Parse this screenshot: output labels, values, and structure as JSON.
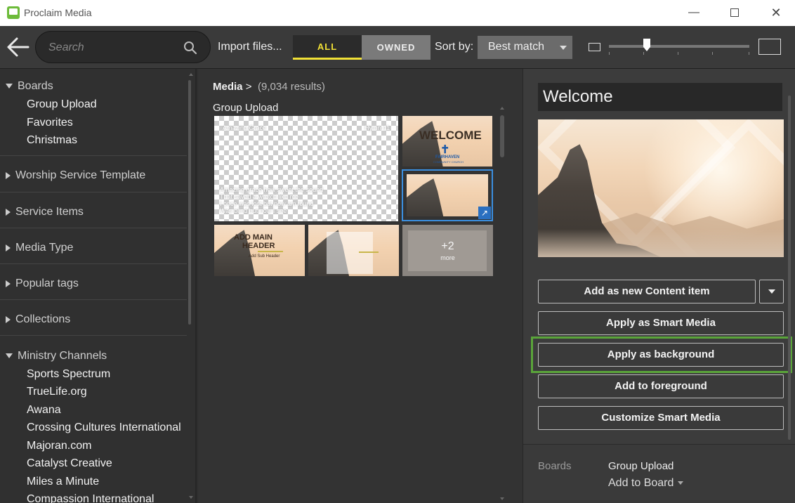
{
  "window": {
    "title": "Proclaim Media",
    "minimize_glyph": "—",
    "close_glyph": "✕"
  },
  "toolbar": {
    "search_placeholder": "Search",
    "import_label": "Import files...",
    "filter_all": "ALL",
    "filter_owned": "OWNED",
    "sort_label": "Sort by:",
    "sort_value": "Best match",
    "thumbnail_size_fraction": 0.27
  },
  "sidebar": {
    "boards": {
      "label": "Boards",
      "items": [
        "Group Upload",
        "Favorites",
        "Christmas"
      ]
    },
    "sections": [
      "Worship Service Template",
      "Service Items",
      "Media Type",
      "Popular tags",
      "Collections"
    ],
    "ministry": {
      "label": "Ministry Channels",
      "items": [
        "Sports Spectrum",
        "TrueLife.org",
        "Awana",
        "Crossing Cultures International",
        "Majoran.com",
        "Catalyst Creative",
        "Miles a Minute",
        "Compassion International"
      ]
    }
  },
  "middle": {
    "breadcrumb": "Media",
    "breadcrumb_chevron": ">",
    "results": "(9,034 results)",
    "group_label": "Group Upload",
    "tile1": {
      "corner_left": "Amazing Grace",
      "corner_right": "Hymn 41",
      "lyrics": [
        "Amazing grace how sweet the sound",
        "That saved a wretch like me",
        "I once was lost but now am found",
        "Was blind but now I see"
      ]
    },
    "tile2": {
      "title": "WELCOME",
      "cross": "✝",
      "brand": "FAIRHAVEN",
      "brand_sub": "COMMUNITY CHURCH"
    },
    "tile3": {
      "expand_glyph": "↗"
    },
    "tile4": {
      "line1": "ADD MAIN",
      "line2": "HEADER",
      "sub": "Add Sub Header"
    },
    "more_count": "+2",
    "more_label": "more"
  },
  "detail": {
    "title": "Welcome",
    "buttons": {
      "add_content": "Add as new Content item",
      "apply_smart": "Apply as Smart Media",
      "apply_background": "Apply as background",
      "add_foreground": "Add to foreground",
      "customize": "Customize Smart Media"
    },
    "boards_label": "Boards",
    "boards_value": "Group Upload",
    "add_to_board": "Add to Board"
  },
  "colors": {
    "accent_yellow": "#f0e036",
    "selection_blue": "#3b8fe0",
    "highlight_green": "#5aa43a"
  }
}
